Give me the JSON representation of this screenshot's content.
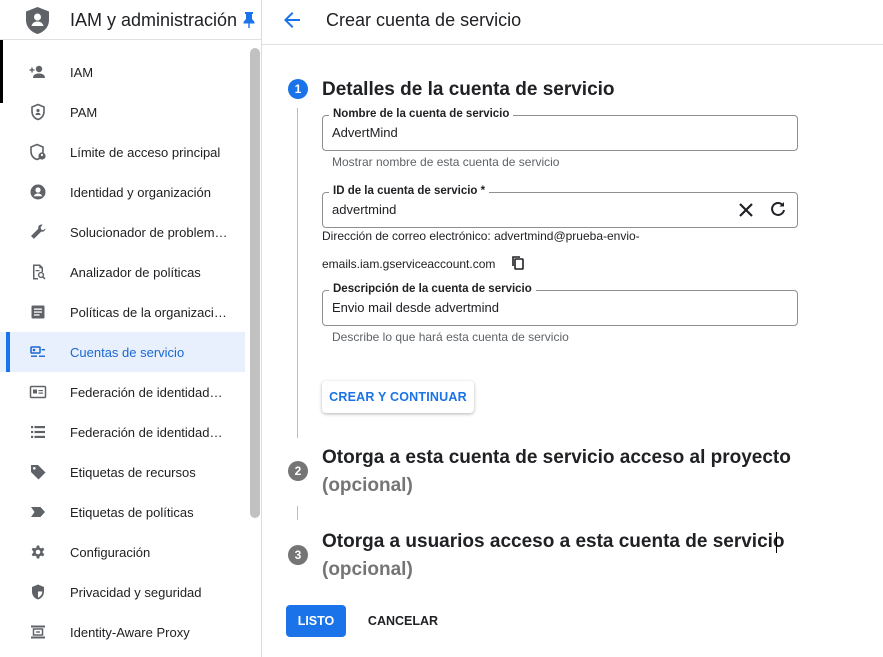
{
  "sidebar": {
    "title": "IAM y administración",
    "items": [
      {
        "label": "IAM",
        "icon": "person-add-icon"
      },
      {
        "label": "PAM",
        "icon": "shield-icon"
      },
      {
        "label": "Límite de acceso principal",
        "icon": "shield-person-icon"
      },
      {
        "label": "Identidad y organización",
        "icon": "account-circle-icon"
      },
      {
        "label": "Solucionador de problemas de políticas",
        "icon": "wrench-icon"
      },
      {
        "label": "Analizador de políticas",
        "icon": "document-search-icon"
      },
      {
        "label": "Políticas de la organización",
        "icon": "list-box-icon"
      },
      {
        "label": "Cuentas de servicio",
        "icon": "service-account-icon",
        "active": true
      },
      {
        "label": "Federación de identidades de carga de trabajo",
        "icon": "id-card-icon"
      },
      {
        "label": "Federación de identidades de personal",
        "icon": "list-icon"
      },
      {
        "label": "Etiquetas de recursos",
        "icon": "tag-icon"
      },
      {
        "label": "Etiquetas de políticas",
        "icon": "label-icon"
      },
      {
        "label": "Configuración",
        "icon": "gear-icon"
      },
      {
        "label": "Privacidad y seguridad",
        "icon": "security-shield-icon"
      },
      {
        "label": "Identity-Aware Proxy",
        "icon": "proxy-icon"
      }
    ]
  },
  "header": {
    "title": "Crear cuenta de servicio"
  },
  "steps": [
    {
      "number": "1",
      "title": "Detalles de la cuenta de servicio"
    },
    {
      "number": "2",
      "title": "Otorga a esta cuenta de servicio acceso al proyecto",
      "subtitle": "(opcional)"
    },
    {
      "number": "3",
      "title": "Otorga a usuarios acceso a esta cuenta de servicio",
      "subtitle": "(opcional)"
    }
  ],
  "form": {
    "name": {
      "label": "Nombre de la cuenta de servicio",
      "value": "AdvertMind",
      "hint": "Mostrar nombre de esta cuenta de servicio"
    },
    "id": {
      "label": "ID de la cuenta de servicio *",
      "value": "advertmind"
    },
    "email_line1": "Dirección de correo electrónico: advertmind@prueba-envio-",
    "email_line2": "emails.iam.gserviceaccount.com",
    "description": {
      "label": "Descripción de la cuenta de servicio",
      "value": "Envio mail desde advertmind",
      "hint": "Describe lo que hará esta cuenta de servicio"
    },
    "create_continue_label": "CREAR Y CONTINUAR"
  },
  "actions": {
    "done_label": "LISTO",
    "cancel_label": "CANCELAR"
  },
  "colors": {
    "accent": "#1a73e8",
    "active_bg": "#e8f0fe",
    "step_inactive": "#757575"
  }
}
